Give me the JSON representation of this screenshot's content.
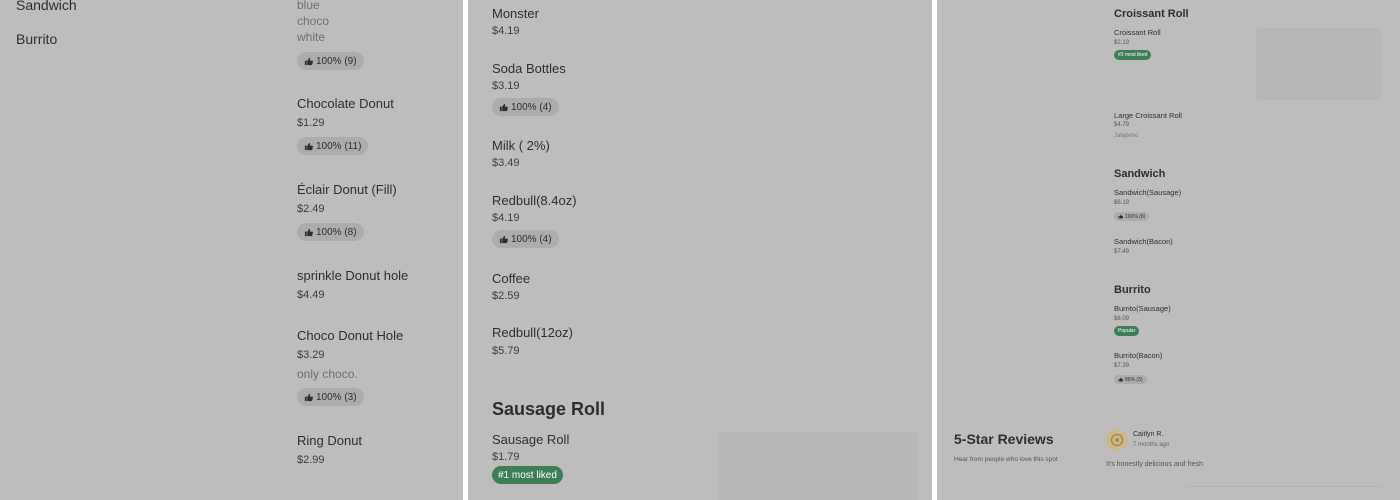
{
  "left": {
    "sidebar": [
      "Sandwich",
      "Burrito"
    ],
    "variations": [
      "blue",
      "choco",
      "white"
    ],
    "first_badge": "100% (9)",
    "items": [
      {
        "name": "Chocolate Donut",
        "price": "$1.29",
        "badge": "100% (11)"
      },
      {
        "name": "Éclair Donut (Fill)",
        "price": "$2.49",
        "badge": "100% (8)"
      },
      {
        "name": "sprinkle Donut hole",
        "price": "$4.49"
      },
      {
        "name": "Choco Donut Hole",
        "price": "$3.29",
        "desc": "only choco.",
        "badge": "100% (3)"
      },
      {
        "name": "Ring Donut",
        "price": "$2.99"
      }
    ]
  },
  "middle": {
    "items": [
      {
        "name": "Monster",
        "price": "$4.19"
      },
      {
        "name": "Soda Bottles",
        "price": "$3.19",
        "badge": "100% (4)"
      },
      {
        "name": "Milk ( 2%)",
        "price": "$3.49"
      },
      {
        "name": "Redbull(8.4oz)",
        "price": "$4.19",
        "badge": "100% (4)"
      },
      {
        "name": "Coffee",
        "price": "$2.59"
      },
      {
        "name": "Redbull(12oz)",
        "price": "$5.79"
      }
    ],
    "section_title": "Sausage Roll",
    "section_item": {
      "name": "Sausage Roll",
      "price": "$1.79",
      "tag": "#1 most liked"
    }
  },
  "right": {
    "croissant": {
      "title": "Croissant Roll",
      "item1": {
        "name": "Croissant Roll",
        "price": "$2.19",
        "tag": "#2 most liked"
      },
      "item2": {
        "name": "Large Croissant Roll",
        "price": "$4.79",
        "desc": "Jalapeno"
      }
    },
    "sandwich": {
      "title": "Sandwich",
      "item1": {
        "name": "Sandwich(Sausage)",
        "price": "$6.19",
        "badge": "100% (8)"
      },
      "item2": {
        "name": "Sandwich(Bacon)",
        "price": "$7.49"
      }
    },
    "burrito": {
      "title": "Burrito",
      "item1": {
        "name": "Burrito(Sausage)",
        "price": "$6.09",
        "tag": "Popular"
      },
      "item2": {
        "name": "Burrito(Bacon)",
        "price": "$7.39",
        "badge": "86% (3)"
      }
    },
    "reviews": {
      "title": "5-Star Reviews",
      "subtitle": "Hear from people who love this spot",
      "reviewer": "Caitlyn R.",
      "time": "7 months ago",
      "text": "It's honestly delicious and fresh"
    }
  },
  "colors": {
    "panel_bg": "#bdbdbd",
    "badge_bg": "#acacac",
    "accent_green": "#3d7d58"
  },
  "icons": [
    "thumbs-up-icon",
    "reviewer-avatar-icon"
  ]
}
